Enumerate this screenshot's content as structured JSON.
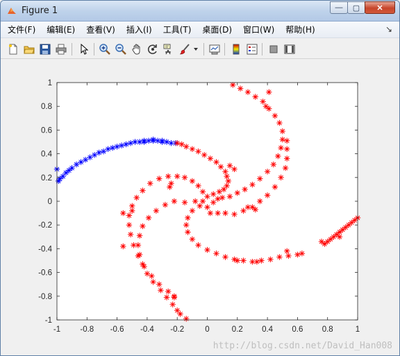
{
  "window": {
    "title": "Figure 1",
    "controls": {
      "minimize": "—",
      "maximize": "▢",
      "close": "✕"
    }
  },
  "menubar": {
    "items": [
      "文件(F)",
      "编辑(E)",
      "查看(V)",
      "插入(I)",
      "工具(T)",
      "桌面(D)",
      "窗口(W)",
      "帮助(H)"
    ]
  },
  "toolbar": {
    "icons": [
      "new-file-icon",
      "open-folder-icon",
      "save-icon",
      "print-icon",
      "pointer-icon",
      "zoom-in-icon",
      "zoom-out-icon",
      "pan-hand-icon",
      "rotate-3d-icon",
      "data-cursor-icon",
      "brush-icon",
      "link-plot-icon",
      "colorbar-icon",
      "legend-icon",
      "hide-plot-tools-icon",
      "show-plot-tools-icon"
    ]
  },
  "watermark": "http://blog.csdn.net/David_Han008",
  "colors": {
    "series_red": "#ff0000",
    "series_blue": "#0000ff"
  },
  "chart_data": {
    "type": "scatter",
    "marker": "*",
    "xlim": [
      -1,
      1
    ],
    "ylim": [
      -1,
      1
    ],
    "xticks": [
      "-1",
      "-0.8",
      "-0.6",
      "-0.4",
      "-0.2",
      "0",
      "0.2",
      "0.4",
      "0.6",
      "0.8",
      "1"
    ],
    "yticks": [
      "1",
      "0.8",
      "0.6",
      "0.4",
      "0.2",
      "0",
      "-0.2",
      "-0.4",
      "-0.6",
      "-0.8",
      "-1"
    ],
    "grid": false,
    "series": [
      {
        "color": "#0000ff",
        "points": [
          [
            -1.0,
            0.27
          ],
          [
            -0.99,
            0.17
          ],
          [
            -0.98,
            0.19
          ],
          [
            -0.96,
            0.21
          ],
          [
            -0.94,
            0.24
          ],
          [
            -0.92,
            0.26
          ],
          [
            -0.9,
            0.28
          ],
          [
            -0.87,
            0.31
          ],
          [
            -0.84,
            0.33
          ],
          [
            -0.81,
            0.35
          ],
          [
            -0.78,
            0.37
          ],
          [
            -0.75,
            0.39
          ],
          [
            -0.72,
            0.41
          ],
          [
            -0.69,
            0.42
          ],
          [
            -0.66,
            0.44
          ],
          [
            -0.63,
            0.45
          ],
          [
            -0.6,
            0.46
          ],
          [
            -0.57,
            0.47
          ],
          [
            -0.54,
            0.48
          ],
          [
            -0.51,
            0.49
          ],
          [
            -0.48,
            0.5
          ],
          [
            -0.45,
            0.5
          ],
          [
            -0.42,
            0.51
          ],
          [
            -0.39,
            0.51
          ],
          [
            -0.36,
            0.51
          ],
          [
            -0.33,
            0.51
          ],
          [
            -0.3,
            0.5
          ],
          [
            -0.27,
            0.5
          ],
          [
            -0.24,
            0.49
          ],
          [
            -0.21,
            0.49
          ],
          [
            -0.42,
            0.5
          ],
          [
            -0.36,
            0.52
          ],
          [
            -0.3,
            0.51
          ]
        ]
      },
      {
        "color": "#ff0000",
        "points": [
          [
            -0.2,
            0.49
          ],
          [
            -0.17,
            0.48
          ],
          [
            -0.14,
            0.46
          ],
          [
            -0.1,
            0.44
          ],
          [
            -0.06,
            0.42
          ],
          [
            -0.02,
            0.39
          ],
          [
            0.02,
            0.36
          ],
          [
            0.06,
            0.33
          ],
          [
            0.09,
            0.29
          ],
          [
            0.12,
            0.25
          ],
          [
            0.13,
            0.21
          ],
          [
            0.14,
            0.17
          ],
          [
            0.13,
            0.13
          ],
          [
            0.11,
            0.1
          ],
          [
            0.08,
            0.08
          ],
          [
            0.04,
            0.06
          ],
          [
            0.0,
            0.04
          ],
          [
            -0.03,
            0.0
          ],
          [
            0.18,
            0.27
          ],
          [
            0.15,
            0.3
          ],
          [
            0.0,
            -0.05
          ],
          [
            0.04,
            -0.01
          ],
          [
            0.07,
            0.02
          ],
          [
            0.1,
            0.03
          ],
          [
            0.15,
            0.04
          ],
          [
            0.2,
            0.07
          ],
          [
            0.25,
            0.1
          ],
          [
            0.3,
            0.14
          ],
          [
            0.35,
            0.19
          ],
          [
            0.4,
            0.25
          ],
          [
            0.44,
            0.31
          ],
          [
            0.47,
            0.38
          ],
          [
            0.49,
            0.45
          ],
          [
            0.5,
            0.52
          ],
          [
            0.5,
            0.59
          ],
          [
            0.48,
            0.66
          ],
          [
            0.45,
            0.72
          ],
          [
            0.41,
            0.78
          ],
          [
            0.37,
            0.84
          ],
          [
            0.32,
            0.88
          ],
          [
            0.27,
            0.92
          ],
          [
            0.22,
            0.95
          ],
          [
            0.17,
            0.98
          ],
          [
            0.41,
            0.92
          ],
          [
            0.53,
            0.51
          ],
          [
            0.39,
            0.8
          ],
          [
            0.02,
            -0.1
          ],
          [
            0.07,
            -0.1
          ],
          [
            0.12,
            -0.1
          ],
          [
            0.18,
            -0.11
          ],
          [
            0.24,
            -0.08
          ],
          [
            0.3,
            -0.05
          ],
          [
            0.35,
            0.0
          ],
          [
            0.4,
            0.05
          ],
          [
            0.45,
            0.12
          ],
          [
            0.49,
            0.2
          ],
          [
            0.52,
            0.28
          ],
          [
            0.53,
            0.36
          ],
          [
            0.53,
            0.44
          ],
          [
            0.27,
            -0.05
          ],
          [
            0.32,
            -0.07
          ],
          [
            -0.05,
            -0.04
          ],
          [
            -0.1,
            -0.08
          ],
          [
            -0.13,
            -0.14
          ],
          [
            -0.14,
            -0.2
          ],
          [
            -0.13,
            -0.26
          ],
          [
            -0.1,
            -0.32
          ],
          [
            -0.06,
            -0.37
          ],
          [
            0.0,
            -0.41
          ],
          [
            0.06,
            -0.44
          ],
          [
            0.12,
            -0.47
          ],
          [
            0.18,
            -0.49
          ],
          [
            0.24,
            -0.5
          ],
          [
            0.3,
            -0.51
          ],
          [
            0.36,
            -0.5
          ],
          [
            0.42,
            -0.49
          ],
          [
            0.48,
            -0.47
          ],
          [
            0.54,
            -0.46
          ],
          [
            0.6,
            -0.45
          ],
          [
            0.63,
            -0.44
          ],
          [
            0.53,
            -0.42
          ],
          [
            0.2,
            -0.5
          ],
          [
            0.33,
            -0.51
          ],
          [
            -0.08,
            0.0
          ],
          [
            -0.15,
            -0.01
          ],
          [
            -0.22,
            0.0
          ],
          [
            -0.28,
            -0.03
          ],
          [
            -0.34,
            -0.08
          ],
          [
            -0.39,
            -0.14
          ],
          [
            -0.43,
            -0.21
          ],
          [
            -0.45,
            -0.29
          ],
          [
            -0.46,
            -0.37
          ],
          [
            -0.45,
            -0.45
          ],
          [
            -0.43,
            -0.53
          ],
          [
            -0.4,
            -0.61
          ],
          [
            -0.36,
            -0.68
          ],
          [
            -0.31,
            -0.75
          ],
          [
            -0.27,
            -0.81
          ],
          [
            -0.23,
            -0.87
          ],
          [
            -0.2,
            -0.92
          ],
          [
            -0.18,
            -0.95
          ],
          [
            -0.14,
            -0.99
          ],
          [
            -0.56,
            -0.1
          ],
          [
            -0.5,
            -0.08
          ],
          [
            -0.56,
            -0.38
          ],
          [
            -0.22,
            -0.8
          ],
          [
            -0.03,
            0.08
          ],
          [
            -0.06,
            0.13
          ],
          [
            -0.1,
            0.17
          ],
          [
            -0.15,
            0.2
          ],
          [
            -0.2,
            0.21
          ],
          [
            -0.26,
            0.21
          ],
          [
            -0.32,
            0.19
          ],
          [
            -0.38,
            0.15
          ],
          [
            -0.43,
            0.09
          ],
          [
            -0.47,
            0.03
          ],
          [
            -0.5,
            -0.04
          ],
          [
            -0.52,
            -0.12
          ],
          [
            -0.52,
            -0.2
          ],
          [
            -0.51,
            -0.28
          ],
          [
            -0.49,
            -0.37
          ],
          [
            -0.46,
            -0.46
          ],
          [
            -0.42,
            -0.55
          ],
          [
            -0.37,
            -0.63
          ],
          [
            -0.32,
            -0.7
          ],
          [
            -0.26,
            -0.76
          ],
          [
            -0.22,
            -0.81
          ],
          [
            -0.24,
            0.15
          ],
          [
            -0.25,
            0.12
          ],
          [
            0.78,
            -0.36
          ],
          [
            0.8,
            -0.34
          ],
          [
            0.82,
            -0.32
          ],
          [
            0.84,
            -0.3
          ],
          [
            0.86,
            -0.28
          ],
          [
            0.88,
            -0.26
          ],
          [
            0.9,
            -0.24
          ],
          [
            0.92,
            -0.22
          ],
          [
            0.94,
            -0.2
          ],
          [
            0.96,
            -0.18
          ],
          [
            0.98,
            -0.16
          ],
          [
            1.0,
            -0.14
          ],
          [
            0.88,
            -0.3
          ],
          [
            0.76,
            -0.34
          ]
        ]
      }
    ]
  }
}
